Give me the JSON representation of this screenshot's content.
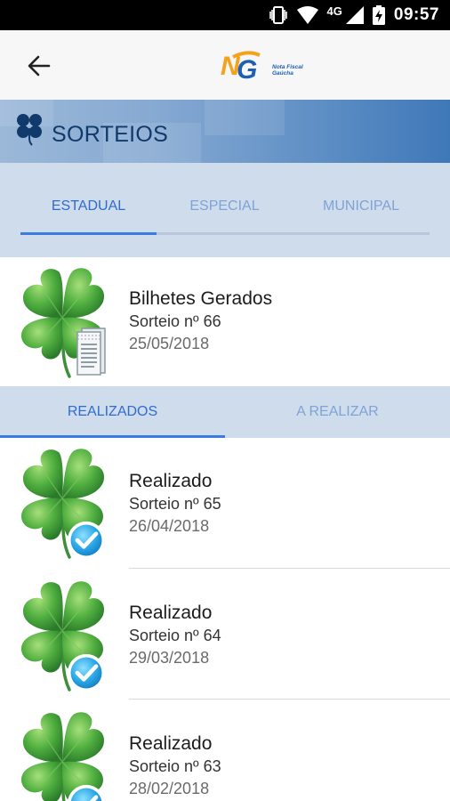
{
  "status_bar": {
    "network": "4G",
    "time": "09:57"
  },
  "header": {
    "logo_caption_line1": "Nota Fiscal",
    "logo_caption_line2": "Gaúcha"
  },
  "banner": {
    "title": "SORTEIOS"
  },
  "top_tabs": [
    {
      "label": "ESTADUAL",
      "active": true
    },
    {
      "label": "ESPECIAL",
      "active": false
    },
    {
      "label": "MUNICIPAL",
      "active": false
    }
  ],
  "current_draw": {
    "title": "Bilhetes Gerados",
    "subtitle": "Sorteio nº 66",
    "date": "25/05/2018"
  },
  "sub_tabs": [
    {
      "label": "REALIZADOS",
      "active": true
    },
    {
      "label": "A REALIZAR",
      "active": false
    }
  ],
  "draws": [
    {
      "title": "Realizado",
      "subtitle": "Sorteio nº 65",
      "date": "26/04/2018"
    },
    {
      "title": "Realizado",
      "subtitle": "Sorteio nº 64",
      "date": "29/03/2018"
    },
    {
      "title": "Realizado",
      "subtitle": "Sorteio nº 63",
      "date": "28/02/2018"
    }
  ],
  "colors": {
    "accent": "#2f6cd0",
    "tab_bar": "#cfdcec",
    "clover": "#3f9e3f",
    "check": "#2aa7e6"
  }
}
